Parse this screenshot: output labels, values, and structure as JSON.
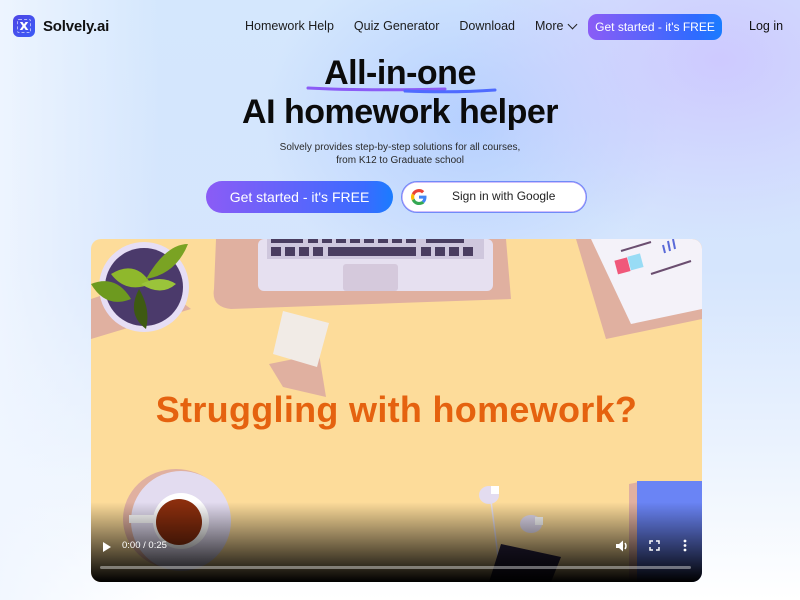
{
  "brand": {
    "name": "Solvely.ai",
    "logo_glyph": "x"
  },
  "nav": {
    "links": [
      {
        "label": "Homework Help"
      },
      {
        "label": "Quiz Generator"
      },
      {
        "label": "Download"
      },
      {
        "label": "More",
        "has_dropdown": true
      }
    ],
    "cta_label": "Get started - it's FREE",
    "login_label": "Log in"
  },
  "hero": {
    "headline_line1": "All-in-one",
    "headline_line2": "AI homework helper",
    "subtitle_line1": "Solvely provides step-by-step solutions for all courses,",
    "subtitle_line2": "from K12 to Graduate school",
    "primary_button": "Get started - it's FREE",
    "google_button": "Sign in with Google"
  },
  "video": {
    "title_overlay": "Struggling with homework?",
    "time_display": "0:00 / 0:25",
    "progress_fraction": 0,
    "controls": [
      "play-icon",
      "volume-icon",
      "fullscreen-icon",
      "more-options-icon"
    ]
  },
  "colors": {
    "accent_purple": "#8b5cf6",
    "accent_blue": "#1a7cff",
    "video_title": "#e5620f",
    "video_bg": "#fddc9a"
  }
}
